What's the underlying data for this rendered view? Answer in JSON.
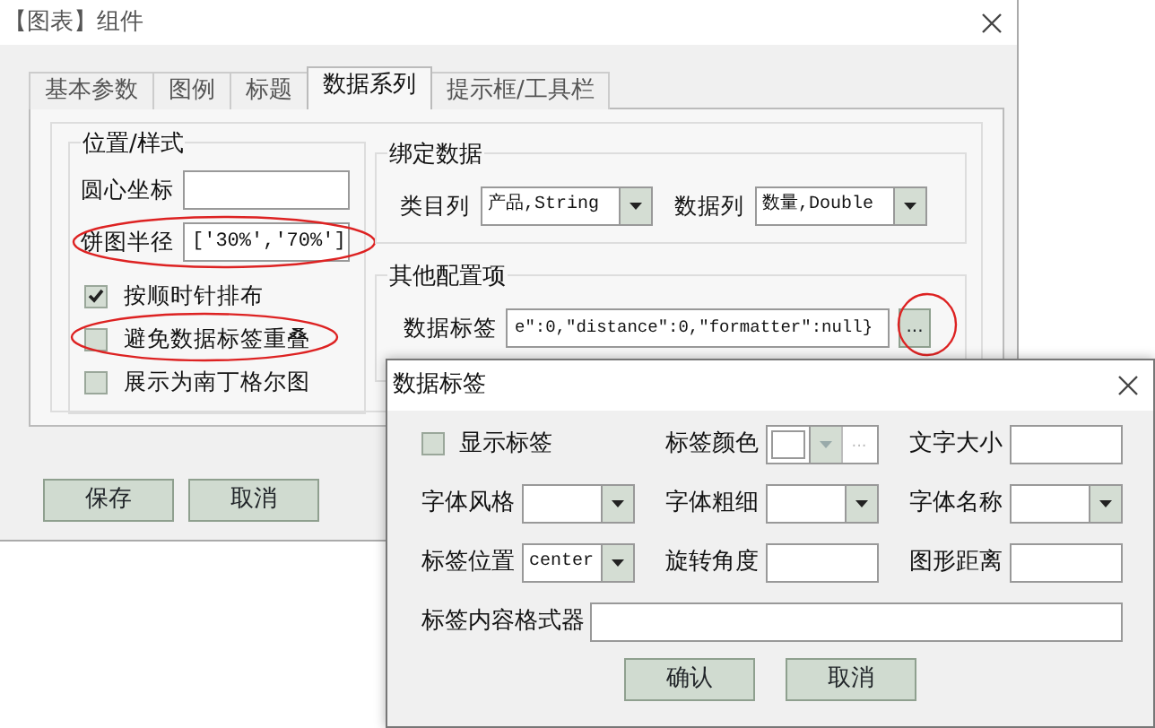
{
  "window": {
    "title": "【图表】组件"
  },
  "tabs": [
    {
      "label": "基本参数",
      "selected": false
    },
    {
      "label": "图例",
      "selected": false
    },
    {
      "label": "标题",
      "selected": false
    },
    {
      "label": "数据系列",
      "selected": true
    },
    {
      "label": "提示框/工具栏",
      "selected": false
    }
  ],
  "position_style": {
    "title": "位置/样式",
    "fields": [
      {
        "label": "圆心坐标",
        "highlighted": false
      },
      {
        "label": "饼图半径",
        "value": "['30%','70%']",
        "highlighted": true
      }
    ],
    "checkboxes": [
      {
        "label": "按顺时针排布",
        "checked": true,
        "highlighted": false
      },
      {
        "label": "避免数据标签重叠",
        "checked": false,
        "highlighted": true
      },
      {
        "label": "展示为南丁格尔图",
        "checked": false,
        "highlighted": false
      }
    ]
  },
  "bind_data": {
    "title": "绑定数据",
    "selects": [
      {
        "label": "类目列",
        "value": "产品,String"
      },
      {
        "label": "数据列",
        "value": "数量,Double"
      }
    ]
  },
  "other_config": {
    "title": "其他配置项",
    "field": {
      "label": "数据标签",
      "value": "e\":0,\"distance\":0,\"formatter\":null}",
      "button": "...",
      "highlighted": true
    }
  },
  "buttons": [
    "保存",
    "取消"
  ],
  "dialog": {
    "title": "数据标签",
    "rows": [
      [
        {
          "kind": "checkbox",
          "label": "显示标签",
          "checked": false
        },
        {
          "kind": "color",
          "label": "标签颜色",
          "button": "...",
          "disabled": true
        },
        {
          "kind": "text",
          "label": "文字大小"
        }
      ],
      [
        {
          "kind": "select",
          "label": "字体风格"
        },
        {
          "kind": "select",
          "label": "字体粗细"
        },
        {
          "kind": "select",
          "label": "字体名称"
        }
      ],
      [
        {
          "kind": "select",
          "label": "标签位置",
          "value": "center"
        },
        {
          "kind": "text",
          "label": "旋转角度"
        },
        {
          "kind": "text",
          "label": "图形距离"
        }
      ],
      [
        {
          "kind": "wide",
          "label": "标签内容格式器"
        }
      ]
    ],
    "buttons": [
      "确认",
      "取消"
    ]
  }
}
